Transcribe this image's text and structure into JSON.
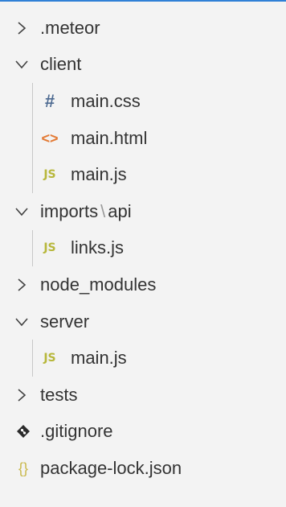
{
  "colors": {
    "accent_bar": "#2f80d6",
    "css_icon": "#4d6a91",
    "html_icon": "#e37933",
    "js_icon": "#b7b73b",
    "json_icon": "#c9b84b"
  },
  "tree": {
    "meteor": {
      "label": ".meteor",
      "icon": "chevron-right-icon"
    },
    "client": {
      "label": "client",
      "icon": "chevron-down-icon",
      "children": {
        "css": {
          "label": "main.css",
          "icon_text": "#",
          "icon": "css-file-icon"
        },
        "html": {
          "label": "main.html",
          "icon_text": "<>",
          "icon": "html-file-icon"
        },
        "js": {
          "label": "main.js",
          "icon_text": "JS",
          "icon": "js-file-icon"
        }
      }
    },
    "imports": {
      "label_a": "imports",
      "separator": "\\",
      "label_b": "api",
      "icon": "chevron-down-icon",
      "children": {
        "links": {
          "label": "links.js",
          "icon_text": "JS",
          "icon": "js-file-icon"
        }
      }
    },
    "node_modules": {
      "label": "node_modules",
      "icon": "chevron-right-icon"
    },
    "server": {
      "label": "server",
      "icon": "chevron-down-icon",
      "children": {
        "main": {
          "label": "main.js",
          "icon_text": "JS",
          "icon": "js-file-icon"
        }
      }
    },
    "tests": {
      "label": "tests",
      "icon": "chevron-right-icon"
    },
    "gitignore": {
      "label": ".gitignore",
      "icon": "git-icon"
    },
    "package_lock": {
      "label": "package-lock.json",
      "icon_text": "{}",
      "icon": "json-file-icon"
    }
  }
}
